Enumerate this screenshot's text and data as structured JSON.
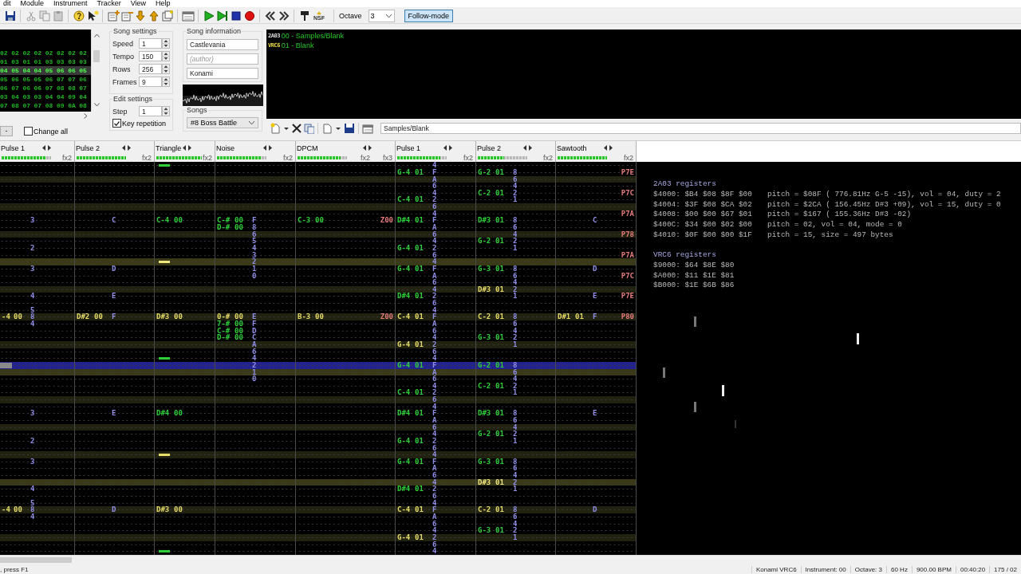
{
  "menu": [
    "dit",
    "Module",
    "Instrument",
    "Tracker",
    "View",
    "Help"
  ],
  "toolbar": {
    "export_label": "NSF",
    "octave_label": "Octave",
    "octave": "3",
    "follow_mode": {
      "label": "Follow-mode",
      "on": true
    }
  },
  "frames": {
    "rows": [
      {
        "selected": false,
        "cells": [
          "02",
          "02",
          "02",
          "02",
          "02",
          "02",
          "02",
          "02"
        ]
      },
      {
        "selected": false,
        "cells": [
          "01",
          "03",
          "01",
          "01",
          "03",
          "03",
          "03",
          "03"
        ]
      },
      {
        "selected": true,
        "cells": [
          "04",
          "05",
          "04",
          "04",
          "05",
          "06",
          "06",
          "05"
        ]
      },
      {
        "selected": false,
        "cells": [
          "05",
          "06",
          "05",
          "05",
          "06",
          "07",
          "07",
          "06"
        ]
      },
      {
        "selected": false,
        "cells": [
          "06",
          "07",
          "06",
          "06",
          "07",
          "08",
          "08",
          "07"
        ]
      },
      {
        "selected": false,
        "cells": [
          "03",
          "04",
          "03",
          "03",
          "04",
          "04",
          "09",
          "04"
        ]
      },
      {
        "selected": false,
        "cells": [
          "07",
          "08",
          "07",
          "07",
          "08",
          "09",
          "0A",
          "08"
        ]
      }
    ],
    "remove_button": "-",
    "change_all": {
      "label": "Change all",
      "checked": false
    }
  },
  "song_settings": {
    "title": "Song settings",
    "fields": [
      {
        "label": "Speed",
        "value": "1"
      },
      {
        "label": "Tempo",
        "value": "150"
      },
      {
        "label": "Rows",
        "value": "256"
      },
      {
        "label": "Frames",
        "value": "9"
      }
    ]
  },
  "edit_settings": {
    "title": "Edit settings",
    "step": {
      "label": "Step",
      "value": "1"
    },
    "key_repetition": {
      "label": "Key repetition",
      "checked": true
    }
  },
  "song_information": {
    "title": "Song information",
    "name": "Castlevania",
    "author_placeholder": "(author)",
    "copyright": "Konami"
  },
  "songs": {
    "label": "Songs",
    "value": "#8 Boss Battle"
  },
  "instruments": {
    "items": [
      {
        "chip": "2A03",
        "label": "00 - Samples/Blank"
      },
      {
        "chip": "VRC6",
        "label": "01 - Blank"
      }
    ],
    "name": "Samples/Blank"
  },
  "channels": [
    {
      "name": "Pulse 1",
      "level": 0.9,
      "effects": [
        "fx2"
      ]
    },
    {
      "name": "Pulse 2",
      "level": 1,
      "effects": [
        "fx2"
      ]
    },
    {
      "name": "Triangle",
      "level": 1,
      "effects": [
        "fx2"
      ]
    },
    {
      "name": "Noise",
      "level": 0.9,
      "effects": [
        "fx2"
      ]
    },
    {
      "name": "DPCM",
      "level": 0.87,
      "effects": [
        "fx2",
        "fx3"
      ]
    },
    {
      "name": "Pulse 1",
      "level": 0.87,
      "effects": [
        "fx2"
      ]
    },
    {
      "name": "Pulse 2",
      "level": 0.53,
      "effects": [
        "fx2"
      ]
    },
    {
      "name": "Sawtooth",
      "level": 1,
      "effects": [
        "fx2"
      ]
    }
  ],
  "pattern": {
    "rows": [
      {
        "highlighted": false,
        "measure": false,
        "selected": false,
        "cells": [
          {},
          {},
          {
            "halt": true
          },
          {},
          {},
          {
            "vol": "4"
          },
          {},
          {}
        ]
      },
      {
        "highlighted": false,
        "measure": false,
        "selected": false,
        "cells": [
          {},
          {},
          {},
          {},
          {},
          {
            "note": "G-4",
            "inst": "01",
            "vol": "F"
          },
          {
            "note": "G-2",
            "inst": "01",
            "vol": "8"
          },
          {
            "fx": "P7E"
          }
        ]
      },
      {
        "highlighted": true,
        "measure": false,
        "selected": false,
        "cells": [
          {},
          {},
          {},
          {},
          {},
          {
            "vol": "A"
          },
          {
            "vol": "6"
          },
          {}
        ]
      },
      {
        "highlighted": false,
        "measure": false,
        "selected": false,
        "cells": [
          {},
          {},
          {},
          {},
          {},
          {
            "vol": "6"
          },
          {
            "vol": "4"
          },
          {}
        ]
      },
      {
        "highlighted": false,
        "measure": false,
        "selected": false,
        "cells": [
          {},
          {},
          {},
          {},
          {},
          {
            "vol": "4"
          },
          {
            "note": "C-2",
            "inst": "01",
            "vol": "2"
          },
          {
            "fx": "P7C"
          }
        ]
      },
      {
        "highlighted": false,
        "measure": false,
        "selected": false,
        "cells": [
          {},
          {},
          {},
          {},
          {},
          {
            "note": "C-4",
            "inst": "01",
            "vol": "2"
          },
          {
            "vol": "1"
          },
          {}
        ]
      },
      {
        "highlighted": true,
        "measure": false,
        "selected": false,
        "cells": [
          {},
          {},
          {},
          {},
          {},
          {
            "vol": "6"
          },
          {},
          {}
        ]
      },
      {
        "highlighted": false,
        "measure": false,
        "selected": false,
        "cells": [
          {},
          {},
          {},
          {},
          {},
          {
            "vol": "4"
          },
          {},
          {
            "fx": "P7A"
          }
        ]
      },
      {
        "highlighted": false,
        "measure": false,
        "selected": false,
        "cells": [
          {
            "vol": "3"
          },
          {
            "vol": "C"
          },
          {
            "note": "C-4",
            "inst": "00"
          },
          {
            "note": "C-#",
            "inst": "00",
            "vol": "F"
          },
          {
            "note": "C-3",
            "inst": "00",
            "fx": "Z00"
          },
          {
            "note": "D#4",
            "inst": "01",
            "vol": "F"
          },
          {
            "note": "D#3",
            "inst": "01",
            "vol": "8"
          },
          {
            "vol": "C"
          }
        ]
      },
      {
        "highlighted": false,
        "measure": false,
        "selected": false,
        "cells": [
          {},
          {},
          {},
          {
            "note": "D-#",
            "inst": "00",
            "vol": "8"
          },
          {},
          {
            "vol": "A"
          },
          {
            "vol": "6"
          },
          {}
        ]
      },
      {
        "highlighted": true,
        "measure": false,
        "selected": false,
        "cells": [
          {},
          {},
          {},
          {
            "vol": "6"
          },
          {},
          {
            "vol": "6"
          },
          {
            "vol": "4"
          },
          {
            "fx": "P78"
          }
        ]
      },
      {
        "highlighted": false,
        "measure": false,
        "selected": false,
        "cells": [
          {},
          {},
          {},
          {
            "vol": "5"
          },
          {},
          {
            "vol": "4"
          },
          {
            "note": "G-2",
            "inst": "01",
            "vol": "2"
          },
          {}
        ]
      },
      {
        "highlighted": false,
        "measure": false,
        "selected": false,
        "cells": [
          {
            "vol": "2"
          },
          {},
          {},
          {
            "vol": "4"
          },
          {},
          {
            "note": "G-4",
            "inst": "01",
            "vol": "2"
          },
          {
            "vol": "1"
          },
          {}
        ]
      },
      {
        "highlighted": false,
        "measure": false,
        "selected": false,
        "cells": [
          {},
          {},
          {},
          {
            "vol": "3"
          },
          {},
          {
            "vol": "6"
          },
          {},
          {
            "fx": "P7A"
          }
        ]
      },
      {
        "highlighted": true,
        "measure": true,
        "selected": false,
        "cells": [
          {},
          {},
          {
            "halt": true
          },
          {
            "vol": "2"
          },
          {},
          {
            "vol": "4"
          },
          {},
          {}
        ]
      },
      {
        "highlighted": false,
        "measure": false,
        "selected": false,
        "cells": [
          {
            "vol": "3"
          },
          {
            "vol": "D"
          },
          {},
          {
            "vol": "1"
          },
          {},
          {
            "note": "G-4",
            "inst": "01",
            "vol": "F"
          },
          {
            "note": "G-3",
            "inst": "01",
            "vol": "8"
          },
          {
            "vol": "D"
          }
        ]
      },
      {
        "highlighted": false,
        "measure": false,
        "selected": false,
        "cells": [
          {},
          {},
          {},
          {
            "vol": "0"
          },
          {},
          {
            "vol": "A"
          },
          {
            "vol": "6"
          },
          {
            "fx": "P7C"
          }
        ]
      },
      {
        "highlighted": false,
        "measure": false,
        "selected": false,
        "cells": [
          {},
          {},
          {},
          {},
          {},
          {
            "vol": "6"
          },
          {
            "vol": "4"
          },
          {}
        ]
      },
      {
        "highlighted": true,
        "measure": false,
        "selected": false,
        "cells": [
          {},
          {},
          {},
          {},
          {},
          {
            "vol": "4"
          },
          {
            "note": "D#3",
            "inst": "01",
            "vol": "2"
          },
          {}
        ]
      },
      {
        "highlighted": false,
        "measure": false,
        "selected": false,
        "cells": [
          {
            "vol": "4"
          },
          {
            "vol": "E"
          },
          {},
          {},
          {},
          {
            "note": "D#4",
            "inst": "01",
            "vol": "2"
          },
          {
            "vol": "1"
          },
          {
            "vol": "E",
            "fx": "P7E"
          }
        ]
      },
      {
        "highlighted": false,
        "measure": false,
        "selected": false,
        "cells": [
          {},
          {},
          {},
          {},
          {},
          {
            "vol": "6"
          },
          {},
          {}
        ]
      },
      {
        "highlighted": false,
        "measure": false,
        "selected": false,
        "cells": [
          {
            "vol": "5"
          },
          {},
          {},
          {},
          {},
          {
            "vol": "4"
          },
          {},
          {}
        ]
      },
      {
        "highlighted": true,
        "measure": false,
        "selected": false,
        "cells": [
          {
            "note": "-4",
            "inst": "00",
            "vol": "8"
          },
          {
            "note": "D#2",
            "inst": "00",
            "vol": "F"
          },
          {
            "note": "D#3",
            "inst": "00"
          },
          {
            "note": "0-#",
            "inst": "00",
            "vol": "E"
          },
          {
            "note": "B-3",
            "inst": "00",
            "fx": "Z00"
          },
          {
            "note": "C-4",
            "inst": "01",
            "vol": "F"
          },
          {
            "note": "C-2",
            "inst": "01",
            "vol": "8"
          },
          {
            "note": "D#1",
            "inst": "01",
            "vol": "F",
            "fx": "P80"
          }
        ]
      },
      {
        "highlighted": false,
        "measure": false,
        "selected": false,
        "cells": [
          {
            "vol": "4"
          },
          {},
          {},
          {
            "note": "7-#",
            "inst": "00",
            "vol": "F"
          },
          {},
          {
            "vol": "A"
          },
          {
            "vol": "6"
          },
          {}
        ]
      },
      {
        "highlighted": false,
        "measure": false,
        "selected": false,
        "cells": [
          {},
          {},
          {},
          {
            "note": "C-#",
            "inst": "00",
            "vol": "D"
          },
          {},
          {
            "vol": "6"
          },
          {
            "vol": "4"
          },
          {}
        ]
      },
      {
        "highlighted": false,
        "measure": false,
        "selected": false,
        "cells": [
          {},
          {},
          {},
          {
            "note": "D-#",
            "inst": "00",
            "vol": "C"
          },
          {},
          {
            "vol": "4"
          },
          {
            "note": "G-3",
            "inst": "01",
            "vol": "2"
          },
          {}
        ]
      },
      {
        "highlighted": true,
        "measure": false,
        "selected": false,
        "cells": [
          {},
          {},
          {},
          {
            "vol": "A"
          },
          {},
          {
            "note": "G-4",
            "inst": "01",
            "vol": "2"
          },
          {
            "vol": "1"
          },
          {}
        ]
      },
      {
        "highlighted": false,
        "measure": false,
        "selected": false,
        "cells": [
          {},
          {},
          {},
          {
            "vol": "6"
          },
          {},
          {
            "vol": "6"
          },
          {},
          {}
        ]
      },
      {
        "highlighted": false,
        "measure": false,
        "selected": false,
        "cells": [
          {},
          {},
          {
            "halt": true
          },
          {
            "vol": "4"
          },
          {},
          {
            "vol": "4"
          },
          {},
          {}
        ]
      },
      {
        "highlighted": false,
        "measure": false,
        "selected": true,
        "cells": [
          {},
          {},
          {},
          {
            "vol": "2"
          },
          {},
          {
            "note": "G-4",
            "inst": "01",
            "vol": "F"
          },
          {
            "note": "G-2",
            "inst": "01",
            "vol": "8"
          },
          {}
        ]
      },
      {
        "highlighted": true,
        "measure": true,
        "selected": false,
        "cells": [
          {},
          {},
          {},
          {
            "vol": "1"
          },
          {},
          {
            "vol": "A"
          },
          {
            "vol": "6"
          },
          {}
        ]
      },
      {
        "highlighted": false,
        "measure": false,
        "selected": false,
        "cells": [
          {},
          {},
          {},
          {
            "vol": "0"
          },
          {},
          {
            "vol": "6"
          },
          {
            "vol": "4"
          },
          {}
        ]
      },
      {
        "highlighted": false,
        "measure": false,
        "selected": false,
        "cells": [
          {},
          {},
          {},
          {},
          {},
          {
            "vol": "4"
          },
          {
            "note": "C-2",
            "inst": "01",
            "vol": "2"
          },
          {}
        ]
      },
      {
        "highlighted": false,
        "measure": false,
        "selected": false,
        "cells": [
          {},
          {},
          {},
          {},
          {},
          {
            "note": "C-4",
            "inst": "01",
            "vol": "2"
          },
          {
            "vol": "1"
          },
          {}
        ]
      },
      {
        "highlighted": true,
        "measure": false,
        "selected": false,
        "cells": [
          {},
          {},
          {},
          {},
          {},
          {
            "vol": "6"
          },
          {},
          {}
        ]
      },
      {
        "highlighted": false,
        "measure": false,
        "selected": false,
        "cells": [
          {},
          {},
          {},
          {},
          {},
          {
            "vol": "4"
          },
          {},
          {}
        ]
      },
      {
        "highlighted": false,
        "measure": false,
        "selected": false,
        "cells": [
          {
            "vol": "3"
          },
          {
            "vol": "E"
          },
          {
            "note": "D#4",
            "inst": "00"
          },
          {},
          {},
          {
            "note": "D#4",
            "inst": "01",
            "vol": "F"
          },
          {
            "note": "D#3",
            "inst": "01",
            "vol": "8"
          },
          {
            "vol": "E"
          }
        ]
      },
      {
        "highlighted": false,
        "measure": false,
        "selected": false,
        "cells": [
          {},
          {},
          {},
          {},
          {},
          {
            "vol": "A"
          },
          {
            "vol": "6"
          },
          {}
        ]
      },
      {
        "highlighted": true,
        "measure": false,
        "selected": false,
        "cells": [
          {},
          {},
          {},
          {},
          {},
          {
            "vol": "6"
          },
          {
            "vol": "4"
          },
          {}
        ]
      },
      {
        "highlighted": false,
        "measure": false,
        "selected": false,
        "cells": [
          {},
          {},
          {},
          {},
          {},
          {
            "vol": "4"
          },
          {
            "note": "G-2",
            "inst": "01",
            "vol": "2"
          },
          {}
        ]
      },
      {
        "highlighted": false,
        "measure": false,
        "selected": false,
        "cells": [
          {
            "vol": "2"
          },
          {},
          {},
          {},
          {},
          {
            "note": "G-4",
            "inst": "01",
            "vol": "2"
          },
          {
            "vol": "1"
          },
          {}
        ]
      },
      {
        "highlighted": false,
        "measure": false,
        "selected": false,
        "cells": [
          {},
          {},
          {},
          {},
          {},
          {
            "vol": "6"
          },
          {},
          {}
        ]
      },
      {
        "highlighted": true,
        "measure": false,
        "selected": false,
        "cells": [
          {},
          {},
          {
            "halt": true
          },
          {},
          {},
          {
            "vol": "4"
          },
          {},
          {}
        ]
      },
      {
        "highlighted": false,
        "measure": false,
        "selected": false,
        "cells": [
          {
            "vol": "3"
          },
          {},
          {},
          {},
          {},
          {
            "note": "G-4",
            "inst": "01",
            "vol": "F"
          },
          {
            "note": "G-3",
            "inst": "01",
            "vol": "8"
          },
          {}
        ]
      },
      {
        "highlighted": false,
        "measure": false,
        "selected": false,
        "cells": [
          {},
          {},
          {},
          {},
          {},
          {
            "vol": "A"
          },
          {
            "vol": "6"
          },
          {}
        ]
      },
      {
        "highlighted": false,
        "measure": false,
        "selected": false,
        "cells": [
          {},
          {},
          {},
          {},
          {},
          {
            "vol": "6"
          },
          {
            "vol": "4"
          },
          {}
        ]
      },
      {
        "highlighted": true,
        "measure": true,
        "selected": false,
        "cells": [
          {},
          {},
          {},
          {},
          {},
          {
            "vol": "4"
          },
          {
            "note": "D#3",
            "inst": "01",
            "vol": "2"
          },
          {}
        ]
      },
      {
        "highlighted": false,
        "measure": false,
        "selected": false,
        "cells": [
          {
            "vol": "4"
          },
          {},
          {},
          {},
          {},
          {
            "note": "D#4",
            "inst": "01",
            "vol": "2"
          },
          {
            "vol": "1"
          },
          {}
        ]
      },
      {
        "highlighted": false,
        "measure": false,
        "selected": false,
        "cells": [
          {},
          {},
          {},
          {},
          {},
          {
            "vol": "6"
          },
          {},
          {}
        ]
      },
      {
        "highlighted": false,
        "measure": false,
        "selected": false,
        "cells": [
          {
            "vol": "5"
          },
          {},
          {},
          {},
          {},
          {
            "vol": "4"
          },
          {},
          {}
        ]
      },
      {
        "highlighted": true,
        "measure": false,
        "selected": false,
        "cells": [
          {
            "note": "-4",
            "inst": "00",
            "vol": "8"
          },
          {
            "vol": "D"
          },
          {
            "note": "D#3",
            "inst": "00"
          },
          {},
          {},
          {
            "note": "C-4",
            "inst": "01",
            "vol": "F"
          },
          {
            "note": "C-2",
            "inst": "01",
            "vol": "8"
          },
          {
            "vol": "D"
          }
        ]
      },
      {
        "highlighted": false,
        "measure": false,
        "selected": false,
        "cells": [
          {
            "vol": "4"
          },
          {},
          {},
          {},
          {},
          {
            "vol": "A"
          },
          {
            "vol": "6"
          },
          {}
        ]
      },
      {
        "highlighted": false,
        "measure": false,
        "selected": false,
        "cells": [
          {},
          {},
          {},
          {},
          {},
          {
            "vol": "6"
          },
          {
            "vol": "4"
          },
          {}
        ]
      },
      {
        "highlighted": false,
        "measure": false,
        "selected": false,
        "cells": [
          {},
          {},
          {},
          {},
          {},
          {
            "vol": "4"
          },
          {
            "note": "G-3",
            "inst": "01",
            "vol": "2"
          },
          {}
        ]
      },
      {
        "highlighted": true,
        "measure": false,
        "selected": false,
        "cells": [
          {},
          {},
          {},
          {},
          {},
          {
            "note": "G-4",
            "inst": "01",
            "vol": "2"
          },
          {
            "vol": "1"
          },
          {}
        ]
      },
      {
        "highlighted": false,
        "measure": false,
        "selected": false,
        "cells": [
          {},
          {},
          {},
          {},
          {},
          {
            "vol": "6"
          },
          {},
          {}
        ]
      },
      {
        "highlighted": false,
        "measure": false,
        "selected": false,
        "cells": [
          {},
          {},
          {
            "halt": true
          },
          {},
          {},
          {
            "vol": "4"
          },
          {},
          {}
        ]
      }
    ]
  },
  "registers": [
    {
      "title": "2A03 registers",
      "lines": [
        {
          "bytes": "$4000: $B4 $08 $8F $00",
          "info": "pitch = $08F ( 776.81Hz G-5 -15), vol = 04, duty = 2"
        },
        {
          "bytes": "$4004: $3F $08 $CA $02",
          "info": "pitch = $2CA ( 156.45Hz D#3 +09), vol = 15, duty = 0"
        },
        {
          "bytes": "$4008: $00 $00 $67 $01",
          "info": "pitch = $167 ( 155.36Hz D#3 -02)"
        },
        {
          "bytes": "$400C: $34 $00 $02 $00",
          "info": "pitch = 02, vol = 04, mode = 0"
        },
        {
          "bytes": "$4010: $0F $00 $00 $1F",
          "info": "pitch = 15, size = 497 bytes"
        }
      ]
    },
    {
      "title": "VRC6 registers",
      "lines": [
        {
          "bytes": "$9000: $64 $8E $80"
        },
        {
          "bytes": "$A000: $11 $1E $81"
        },
        {
          "bytes": "$B000: $1E $6B $86"
        }
      ]
    }
  ],
  "status_bar": {
    "hint": ", press F1",
    "fields": [
      "Konami VRC6",
      "Instrument: 00",
      "Octave: 3",
      "60 Hz",
      "900.00 BPM",
      "00:40:20",
      "175 / 02"
    ]
  }
}
